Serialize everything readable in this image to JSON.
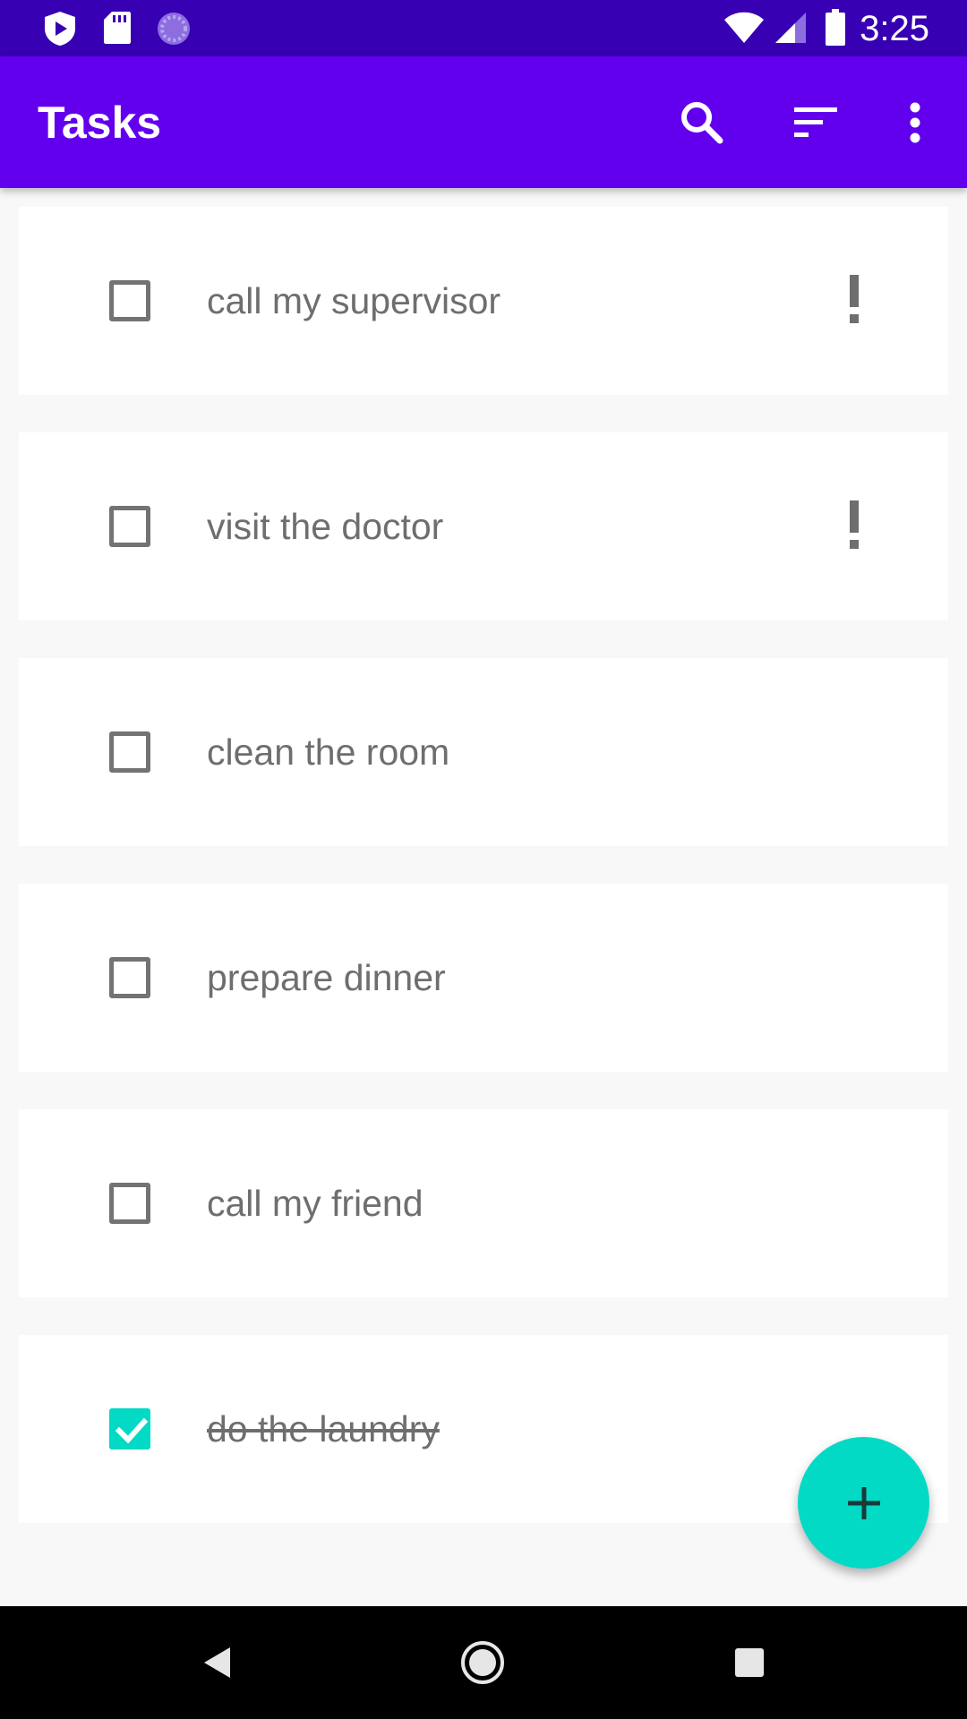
{
  "status_bar": {
    "time": "3:25",
    "icons": [
      "shield-play-icon",
      "sd-card-icon",
      "sync-circle-icon",
      "wifi-icon",
      "signal-icon",
      "battery-icon"
    ]
  },
  "app_bar": {
    "title": "Tasks",
    "actions": [
      "search-icon",
      "sort-icon",
      "more-vert-icon"
    ]
  },
  "tasks": [
    {
      "label": "call my supervisor",
      "checked": false,
      "important": true
    },
    {
      "label": "visit the doctor",
      "checked": false,
      "important": true
    },
    {
      "label": "clean the room",
      "checked": false,
      "important": false
    },
    {
      "label": "prepare dinner",
      "checked": false,
      "important": false
    },
    {
      "label": "call my friend",
      "checked": false,
      "important": false
    },
    {
      "label": "do the laundry",
      "checked": true,
      "important": false
    }
  ],
  "fab": {
    "icon": "add-icon"
  },
  "nav_bar": {
    "buttons": [
      "back-icon",
      "home-icon",
      "recents-icon"
    ]
  },
  "colors": {
    "status_bar": "#3700b3",
    "app_bar": "#6200ee",
    "accent": "#03dac5",
    "text": "#6e6e6e",
    "background": "#f8f8f8"
  }
}
